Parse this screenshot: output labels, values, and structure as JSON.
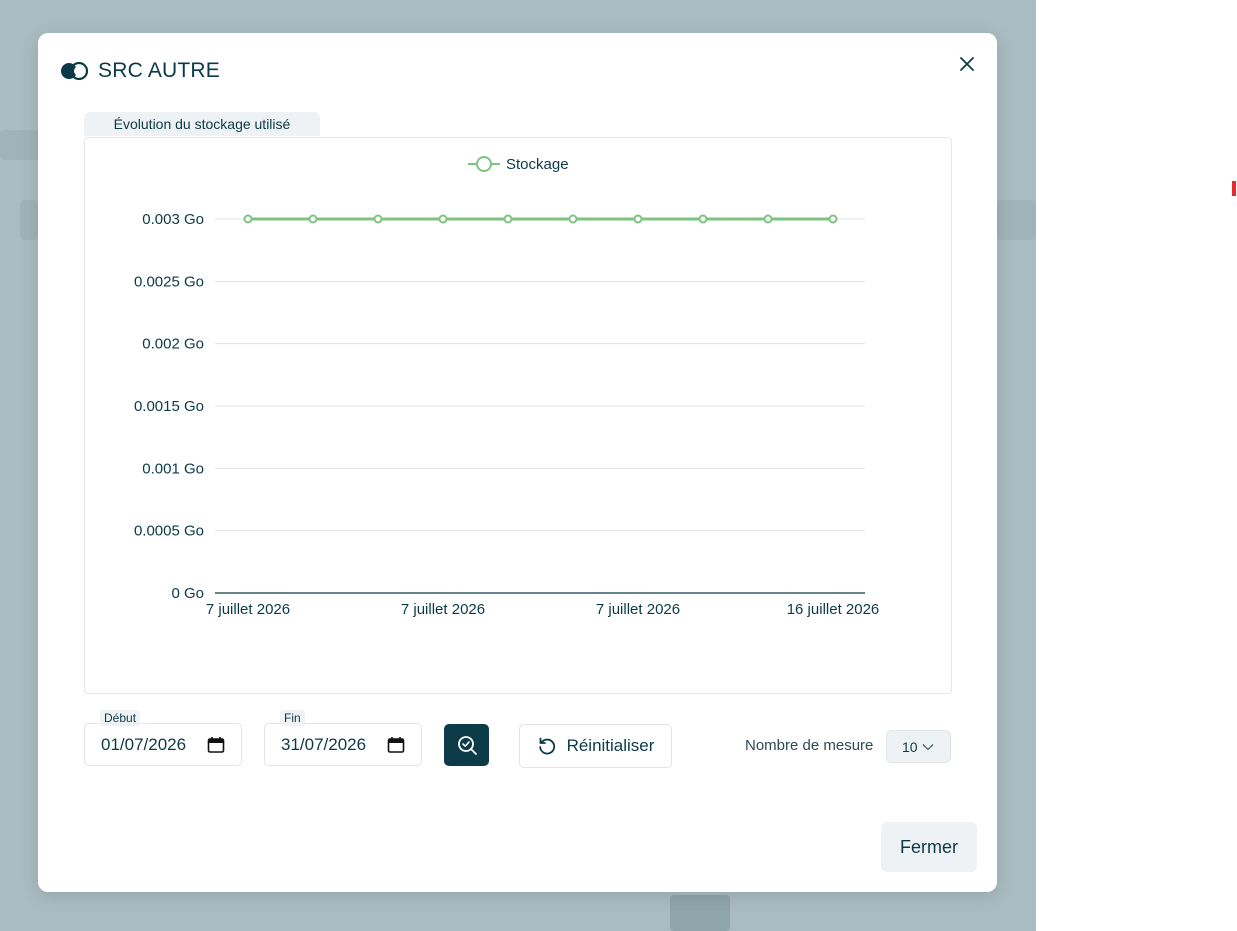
{
  "modal": {
    "title": "SRC AUTRE",
    "chart_tab": "Évolution du stockage utilisé",
    "start_label": "Début",
    "start_value": "01/07/2026",
    "end_label": "Fin",
    "end_value": "31/07/2026",
    "reset_label": "Réinitialiser",
    "measure_label": "Nombre de mesure",
    "measure_value": "10",
    "close_label": "Fermer"
  },
  "colors": {
    "accent": "#0c3c47",
    "series": "#7cc47f",
    "backdrop": "#a9bcc1"
  },
  "chart_data": {
    "type": "line",
    "title": "",
    "xlabel": "",
    "ylabel": "",
    "legend": [
      "Stockage"
    ],
    "legend_position": "top",
    "grid": true,
    "ylim": [
      0,
      0.003
    ],
    "y_ticks": [
      "0 Go",
      "0.0005 Go",
      "0.001 Go",
      "0.0015 Go",
      "0.002 Go",
      "0.0025 Go",
      "0.003 Go"
    ],
    "x_tick_labels": [
      "7 juillet 2026",
      "7 juillet 2026",
      "7 juillet 2026",
      "16 juillet 2026"
    ],
    "series": [
      {
        "name": "Stockage",
        "values": [
          0.003,
          0.003,
          0.003,
          0.003,
          0.003,
          0.003,
          0.003,
          0.003,
          0.003,
          0.003
        ]
      }
    ]
  }
}
